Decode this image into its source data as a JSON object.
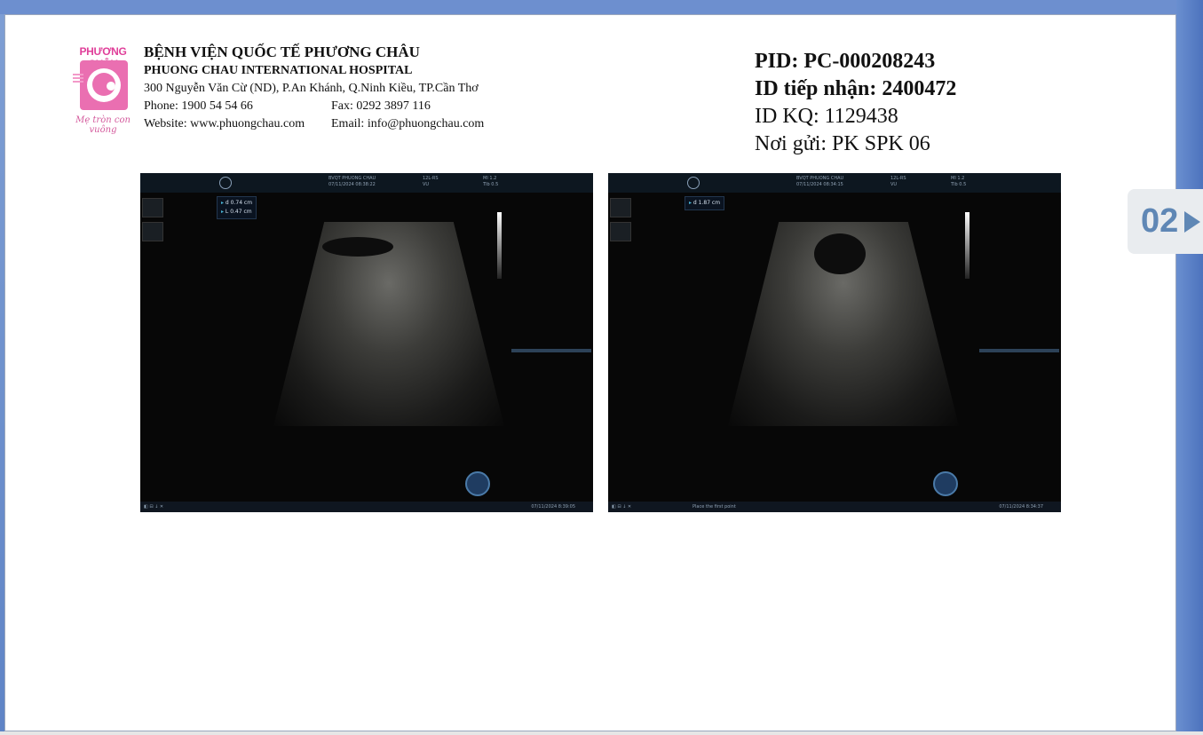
{
  "logo": {
    "brand_text": "PHƯƠNG CHÂU",
    "slogan": "Mẹ tròn con vuông"
  },
  "hospital": {
    "name_vn": "BỆNH VIỆN QUỐC TẾ PHƯƠNG CHÂU",
    "name_en": "PHUONG CHAU INTERNATIONAL HOSPITAL",
    "address": "300 Nguyễn Văn Cừ (ND), P.An Khánh, Q.Ninh Kiều, TP.Cần Thơ",
    "phone": "Phone: 1900 54 54 66",
    "fax": "Fax: 0292 3897 116",
    "website": "Website: www.phuongchau.com",
    "email": "Email: info@phuongchau.com"
  },
  "ids": {
    "pid": "PID: PC-000208243",
    "reception_id": "ID tiếp nhận: 2400472",
    "result_id": "ID KQ: 1129438",
    "sender": "Nơi gửi: PK SPK 06"
  },
  "images": [
    {
      "header": {
        "facility": "BVQT PHUONG CHAU",
        "datetime": "07/11/2024 08:38:22",
        "probe": "12L-RS",
        "preset": "VU",
        "mi": "MI 1.2",
        "tib": "TIb 0.5"
      },
      "measurements": [
        {
          "label": "d",
          "value": "0.74 cm"
        },
        {
          "label": "L",
          "value": "0.47 cm"
        }
      ],
      "footer": {
        "status": "",
        "time": "07/11/2024 8:39:05"
      }
    },
    {
      "header": {
        "facility": "BVQT PHUONG CHAU",
        "datetime": "07/11/2024 08:34:15",
        "probe": "12L-RS",
        "preset": "VU",
        "mi": "MI 1.2",
        "tib": "TIb 0.5"
      },
      "measurements": [
        {
          "label": "d",
          "value": "1.87 cm"
        }
      ],
      "footer": {
        "status": "Place the first point",
        "time": "07/11/2024 8:34:37"
      }
    }
  ],
  "navigation": {
    "page_indicator": "02"
  },
  "colors": {
    "brand_pink": "#ea6fb1",
    "nav_blue": "#5f87b5",
    "window_blue": "#6d8fcf"
  }
}
